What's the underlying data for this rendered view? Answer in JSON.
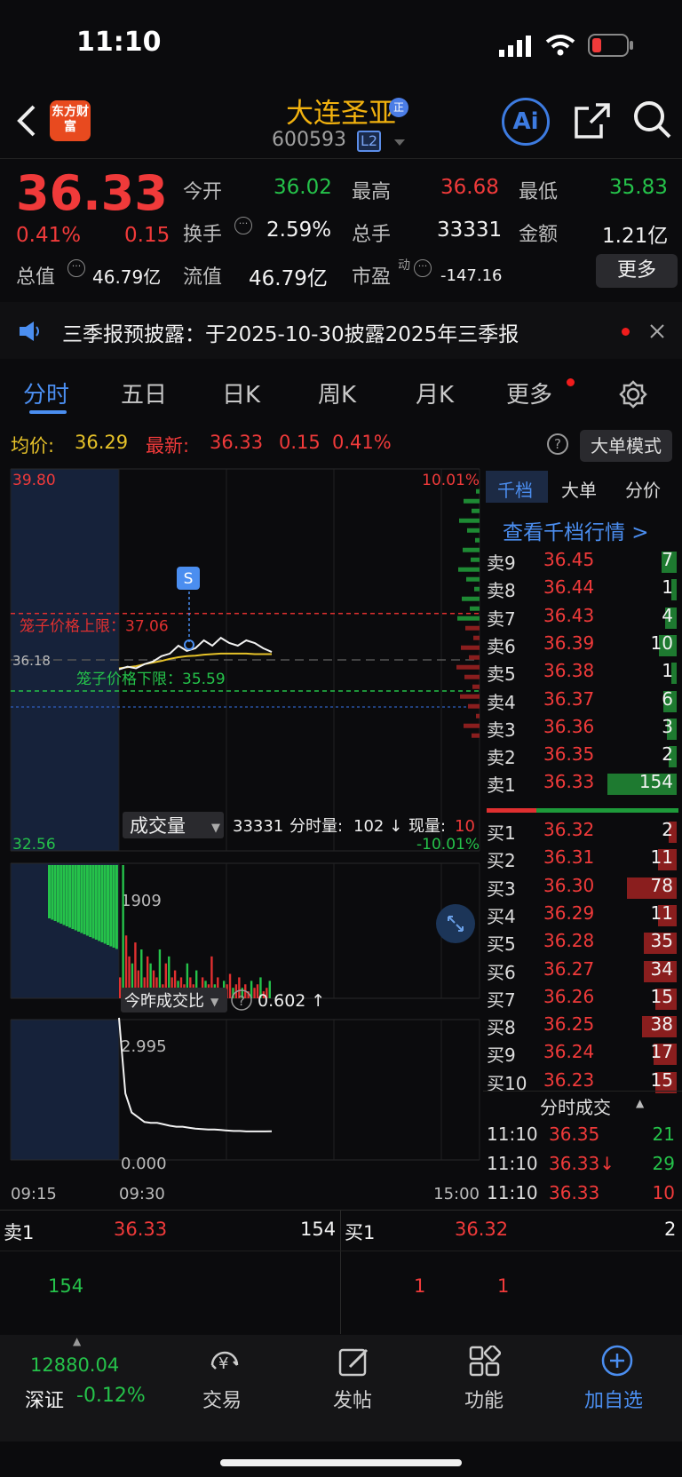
{
  "status_bar": {
    "time": "11:10"
  },
  "header": {
    "logo_text": "东方财富",
    "stock_name": "大连圣亚",
    "code": "600593",
    "level_badge": "L2",
    "ai_label": "Ai"
  },
  "quote": {
    "price": "36.33",
    "change_pct": "0.41%",
    "change": "0.15",
    "fields": [
      {
        "label": "今开",
        "value": "36.02"
      },
      {
        "label": "最高",
        "value": "36.68"
      },
      {
        "label": "最低",
        "value": "35.83"
      },
      {
        "label": "换手",
        "value": "2.59%"
      },
      {
        "label": "总手",
        "value": "33331"
      },
      {
        "label": "金额",
        "value": "1.21亿"
      },
      {
        "label": "总值",
        "value": "46.79亿"
      },
      {
        "label": "流值",
        "value": "46.79亿"
      },
      {
        "label": "市盈",
        "value": "-147.16",
        "sup": "动"
      }
    ],
    "more_label": "更多"
  },
  "notice": {
    "text": "三季报预披露：于2025-10-30披露2025年三季报"
  },
  "tabs": [
    "分时",
    "五日",
    "日K",
    "周K",
    "月K",
    "更多"
  ],
  "info_bar": {
    "avg_label": "均价:",
    "avg_value": "36.29",
    "latest_label": "最新:",
    "latest_value": "36.33",
    "change": "0.15",
    "change_pct": "0.41%",
    "mode_button": "大单模式"
  },
  "chart_data": [
    {
      "type": "line",
      "y_max_label": "39.80",
      "y_min_label": "32.56",
      "pct_max_label": "10.01%",
      "pct_min_label": "-10.01%",
      "ylim": [
        32.56,
        39.8
      ],
      "prev_close_label": "36.18",
      "upper_limit_label": "笼子价格上限：37.06",
      "lower_limit_label": "笼子价格下限：35.59",
      "x_labels": [
        "09:15",
        "09:30",
        "15:00"
      ],
      "series": [
        {
          "values": [
            36.0,
            36.05,
            36.02,
            36.1,
            36.15,
            36.25,
            36.3,
            36.45,
            36.35,
            36.4,
            36.55,
            36.45,
            36.6,
            36.5,
            36.45,
            36.55,
            36.5,
            36.4,
            36.33
          ]
        },
        {
          "values": [
            36.02,
            36.04,
            36.06,
            36.1,
            36.13,
            36.16,
            36.2,
            36.23,
            36.25,
            36.26,
            36.28,
            36.29,
            36.3,
            36.3,
            36.3,
            36.3,
            36.29,
            36.29,
            36.29
          ]
        }
      ]
    },
    {
      "type": "bar",
      "title": "成交量",
      "total": "33331",
      "minute_label": "分时量:",
      "minute_value": "102 ↓",
      "now_label": "现量:",
      "now_value": "10",
      "max_label": "1909",
      "values": [
        300,
        1909,
        900,
        600,
        500,
        800,
        400,
        700,
        300,
        600,
        500,
        400,
        300,
        700,
        200,
        500,
        600,
        300,
        400,
        250,
        300,
        200,
        500,
        300,
        200,
        400,
        150,
        300,
        250,
        200,
        600,
        200,
        300,
        150,
        250,
        200,
        350,
        150,
        200,
        300,
        150,
        200,
        100,
        250,
        150,
        200,
        300,
        100,
        150,
        250
      ]
    },
    {
      "type": "line",
      "title": "今昨成交比",
      "value": "0.602 ↑",
      "max_label": "2.995",
      "min_label": "0.000",
      "values": [
        2.995,
        1.4,
        1.0,
        0.9,
        0.8,
        0.78,
        0.78,
        0.75,
        0.72,
        0.7,
        0.7,
        0.68,
        0.66,
        0.65,
        0.64,
        0.64,
        0.63,
        0.62,
        0.61,
        0.61,
        0.6,
        0.6,
        0.6,
        0.6,
        0.602
      ]
    }
  ],
  "order_book": {
    "tabs": [
      "千档",
      "大单",
      "分价"
    ],
    "link": "查看千档行情 >",
    "asks": [
      {
        "label": "卖9",
        "price": "36.45",
        "vol": "7"
      },
      {
        "label": "卖8",
        "price": "36.44",
        "vol": "1"
      },
      {
        "label": "卖7",
        "price": "36.43",
        "vol": "4"
      },
      {
        "label": "卖6",
        "price": "36.39",
        "vol": "10"
      },
      {
        "label": "卖5",
        "price": "36.38",
        "vol": "1"
      },
      {
        "label": "卖4",
        "price": "36.37",
        "vol": "6"
      },
      {
        "label": "卖3",
        "price": "36.36",
        "vol": "3"
      },
      {
        "label": "卖2",
        "price": "36.35",
        "vol": "2"
      },
      {
        "label": "卖1",
        "price": "36.33",
        "vol": "154"
      }
    ],
    "bids": [
      {
        "label": "买1",
        "price": "36.32",
        "vol": "2"
      },
      {
        "label": "买2",
        "price": "36.31",
        "vol": "11"
      },
      {
        "label": "买3",
        "price": "36.30",
        "vol": "78"
      },
      {
        "label": "买4",
        "price": "36.29",
        "vol": "11"
      },
      {
        "label": "买5",
        "price": "36.28",
        "vol": "35"
      },
      {
        "label": "买6",
        "price": "36.27",
        "vol": "34"
      },
      {
        "label": "买7",
        "price": "36.26",
        "vol": "15"
      },
      {
        "label": "买8",
        "price": "36.25",
        "vol": "38"
      },
      {
        "label": "买9",
        "price": "36.24",
        "vol": "17"
      },
      {
        "label": "买10",
        "price": "36.23",
        "vol": "15"
      }
    ]
  },
  "ticks": {
    "title": "分时成交",
    "rows": [
      {
        "time": "11:10",
        "price": "36.35",
        "vol": "21"
      },
      {
        "time": "11:10",
        "price": "36.33↓",
        "vol": "29"
      },
      {
        "time": "11:10",
        "price": "36.33",
        "vol": "10"
      }
    ]
  },
  "bottom_trade": {
    "sell_label": "卖1",
    "sell_price": "36.33",
    "sell_vol": "154",
    "buy_label": "买1",
    "buy_price": "36.32",
    "buy_vol": "2",
    "sell_detail": "154",
    "buy_detail_1": "1",
    "buy_detail_2": "1"
  },
  "nav": {
    "index_value": "12880.04",
    "index_name": "深证",
    "index_change": "-0.12%",
    "items": [
      "交易",
      "发帖",
      "功能",
      "加自选"
    ]
  }
}
